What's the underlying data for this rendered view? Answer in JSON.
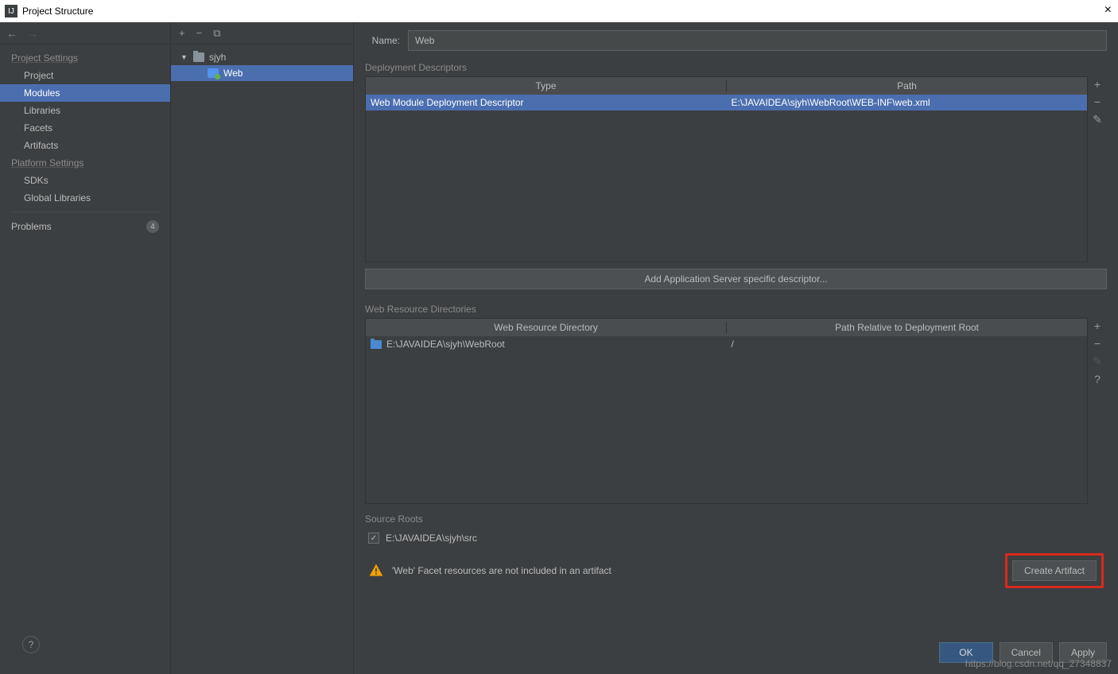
{
  "window": {
    "title": "Project Structure"
  },
  "sidebar": {
    "back_enabled": true,
    "forward_enabled": false,
    "sections": {
      "project_settings": "Project Settings",
      "platform_settings": "Platform Settings"
    },
    "items": {
      "project": "Project",
      "modules": "Modules",
      "libraries": "Libraries",
      "facets": "Facets",
      "artifacts": "Artifacts",
      "sdks": "SDKs",
      "global_libraries": "Global Libraries"
    },
    "problems": {
      "label": "Problems",
      "count": "4"
    }
  },
  "tree": {
    "module": "sjyh",
    "facet": "Web"
  },
  "details": {
    "name_label": "Name:",
    "name_value": "Web",
    "dd": {
      "section": "Deployment Descriptors",
      "col_type": "Type",
      "col_path": "Path",
      "row_type": "Web Module Deployment Descriptor",
      "row_path": "E:\\JAVAIDEA\\sjyh\\WebRoot\\WEB-INF\\web.xml"
    },
    "add_server_btn": "Add Application Server specific descriptor...",
    "wrd": {
      "section": "Web Resource Directories",
      "col_dir": "Web Resource Directory",
      "col_rel": "Path Relative to Deployment Root",
      "row_dir": "E:\\JAVAIDEA\\sjyh\\WebRoot",
      "row_rel": "/"
    },
    "source_roots": {
      "section": "Source Roots",
      "item": "E:\\JAVAIDEA\\sjyh\\src"
    },
    "warning": "'Web' Facet resources are not included in an artifact",
    "create_artifact": "Create Artifact"
  },
  "footer": {
    "ok": "OK",
    "cancel": "Cancel",
    "apply": "Apply"
  },
  "watermark": "https://blog.csdn.net/qq_27348837"
}
